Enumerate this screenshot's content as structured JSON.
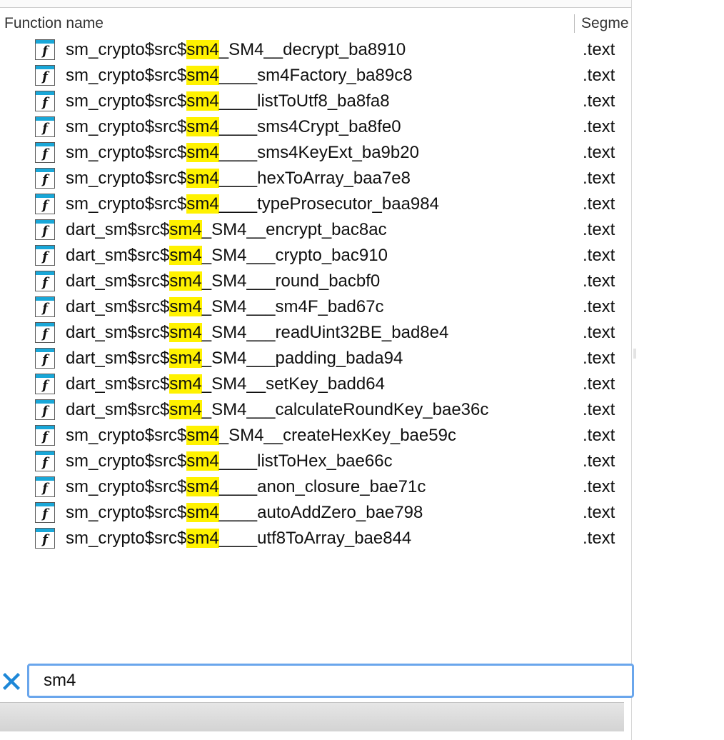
{
  "columns": {
    "name": "Function name",
    "segment": "Segme"
  },
  "highlight_color": "#fff200",
  "accent_color": "#19a7d8",
  "icons": {
    "function": "function-icon",
    "clear": "clear-filter-icon"
  },
  "function_icon_glyph": "f",
  "rows": [
    {
      "prefix": "sm_crypto$src$",
      "match": "sm4",
      "suffix": "_SM4__decrypt_ba8910",
      "segment": ".text"
    },
    {
      "prefix": "sm_crypto$src$",
      "match": "sm4",
      "suffix": "____sm4Factory_ba89c8",
      "segment": ".text"
    },
    {
      "prefix": "sm_crypto$src$",
      "match": "sm4",
      "suffix": "____listToUtf8_ba8fa8",
      "segment": ".text"
    },
    {
      "prefix": "sm_crypto$src$",
      "match": "sm4",
      "suffix": "____sms4Crypt_ba8fe0",
      "segment": ".text"
    },
    {
      "prefix": "sm_crypto$src$",
      "match": "sm4",
      "suffix": "____sms4KeyExt_ba9b20",
      "segment": ".text"
    },
    {
      "prefix": "sm_crypto$src$",
      "match": "sm4",
      "suffix": "____hexToArray_baa7e8",
      "segment": ".text"
    },
    {
      "prefix": "sm_crypto$src$",
      "match": "sm4",
      "suffix": "____typeProsecutor_baa984",
      "segment": ".text"
    },
    {
      "prefix": "dart_sm$src$",
      "match": "sm4",
      "suffix": "_SM4__encrypt_bac8ac",
      "segment": ".text"
    },
    {
      "prefix": "dart_sm$src$",
      "match": "sm4",
      "suffix": "_SM4___crypto_bac910",
      "segment": ".text"
    },
    {
      "prefix": "dart_sm$src$",
      "match": "sm4",
      "suffix": "_SM4___round_bacbf0",
      "segment": ".text"
    },
    {
      "prefix": "dart_sm$src$",
      "match": "sm4",
      "suffix": "_SM4___sm4F_bad67c",
      "segment": ".text"
    },
    {
      "prefix": "dart_sm$src$",
      "match": "sm4",
      "suffix": "_SM4___readUint32BE_bad8e4",
      "segment": ".text"
    },
    {
      "prefix": "dart_sm$src$",
      "match": "sm4",
      "suffix": "_SM4___padding_bada94",
      "segment": ".text"
    },
    {
      "prefix": "dart_sm$src$",
      "match": "sm4",
      "suffix": "_SM4__setKey_badd64",
      "segment": ".text"
    },
    {
      "prefix": "dart_sm$src$",
      "match": "sm4",
      "suffix": "_SM4___calculateRoundKey_bae36c",
      "segment": ".text"
    },
    {
      "prefix": "sm_crypto$src$",
      "match": "sm4",
      "suffix": "_SM4__createHexKey_bae59c",
      "segment": ".text"
    },
    {
      "prefix": "sm_crypto$src$",
      "match": "sm4",
      "suffix": "____listToHex_bae66c",
      "segment": ".text"
    },
    {
      "prefix": "sm_crypto$src$",
      "match": "sm4",
      "suffix": "____anon_closure_bae71c",
      "segment": ".text"
    },
    {
      "prefix": "sm_crypto$src$",
      "match": "sm4",
      "suffix": "____autoAddZero_bae798",
      "segment": ".text"
    },
    {
      "prefix": "sm_crypto$src$",
      "match": "sm4",
      "suffix": "____utf8ToArray_bae844",
      "segment": ".text"
    }
  ],
  "search": {
    "value": "sm4"
  }
}
